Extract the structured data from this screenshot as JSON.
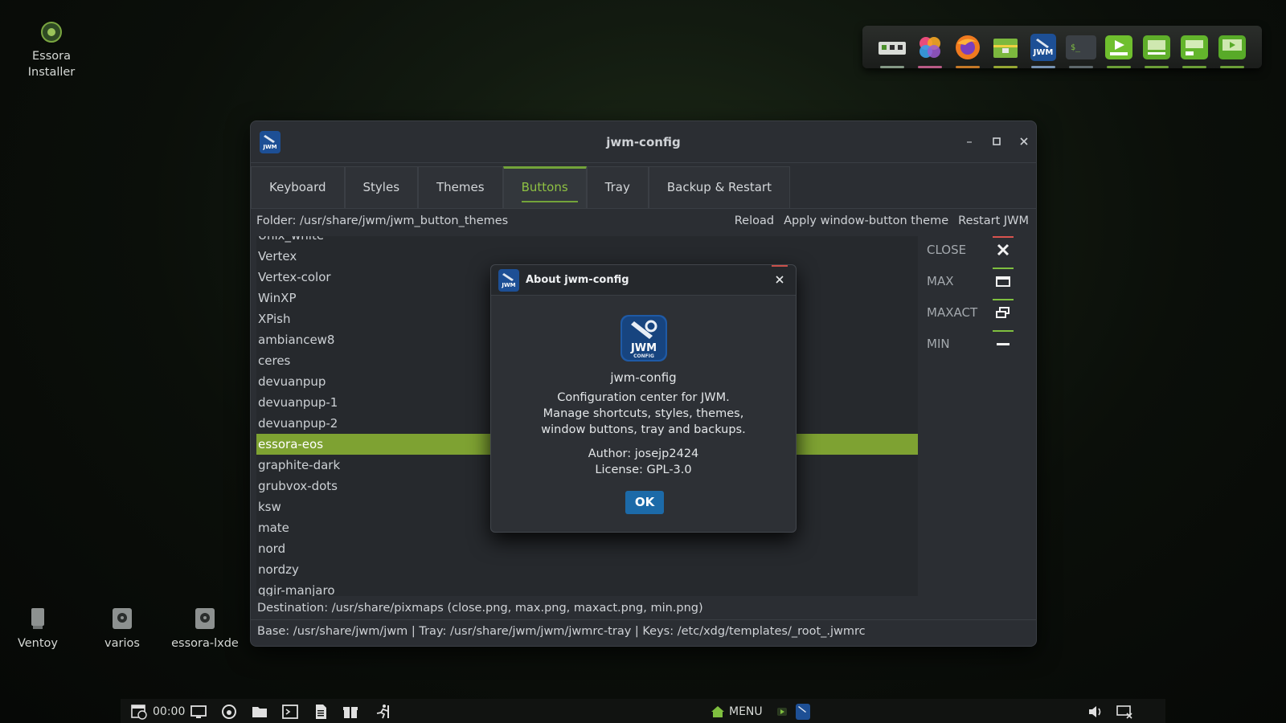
{
  "desktop": {
    "icons": [
      {
        "label_line1": "Essora",
        "label_line2": "Installer"
      },
      {
        "label": "Ventoy"
      },
      {
        "label": "varios"
      },
      {
        "label": "essora-lxde"
      }
    ]
  },
  "dock": {
    "items": [
      "network-icon",
      "color-palette-icon",
      "firefox-icon",
      "archive-icon",
      "jwm-config-icon",
      "terminal-icon",
      "oply-icon",
      "oply-radio-icon",
      "oply-control-icon",
      "oply-video-icon"
    ],
    "accent": "#7fbf3f"
  },
  "window": {
    "title": "jwm-config",
    "tabs": [
      "Keyboard",
      "Styles",
      "Themes",
      "Buttons",
      "Tray",
      "Backup & Restart"
    ],
    "active_tab": "Buttons",
    "folder": "Folder: /usr/share/jwm/jwm_button_themes",
    "actions": [
      "Reload",
      "Apply window-button theme",
      "Restart JWM"
    ],
    "themes": [
      "Unix_white",
      "Vertex",
      "Vertex-color",
      "WinXP",
      "XPish",
      "ambiancew8",
      "ceres",
      "devuanpup",
      "devuanpup-1",
      "devuanpup-2",
      "essora-eos",
      "graphite-dark",
      "grubvox-dots",
      "ksw",
      "mate",
      "nord",
      "nordzy",
      "qgir-manjaro"
    ],
    "selected_theme": "essora-eos",
    "preview": {
      "close_label": "CLOSE",
      "max_label": "MAX",
      "maxact_label": "MAXACT",
      "min_label": "MIN",
      "close_color": "#d9534f",
      "accent_color": "#7fbf3f"
    },
    "destination": "Destination: /usr/share/pixmaps (close.png, max.png, maxact.png, min.png)",
    "base_info": "Base: /usr/share/jwm/jwm  |  Tray: /usr/share/jwm/jwm/jwmrc-tray  |  Keys: /etc/xdg/templates/_root_.jwmrc"
  },
  "about": {
    "title": "About jwm-config",
    "logo_text_1": "JWM",
    "logo_text_2": "CONFIG",
    "app_name": "jwm-config",
    "desc_line1": "Configuration center for JWM.",
    "desc_line2": "Manage shortcuts, styles, themes,",
    "desc_line3": "window buttons, tray and backups.",
    "author": "Author: josejp2424",
    "license": "License: GPL-3.0",
    "ok_label": "OK"
  },
  "taskbar": {
    "clock": "00:00",
    "menu_label": "MENU"
  }
}
